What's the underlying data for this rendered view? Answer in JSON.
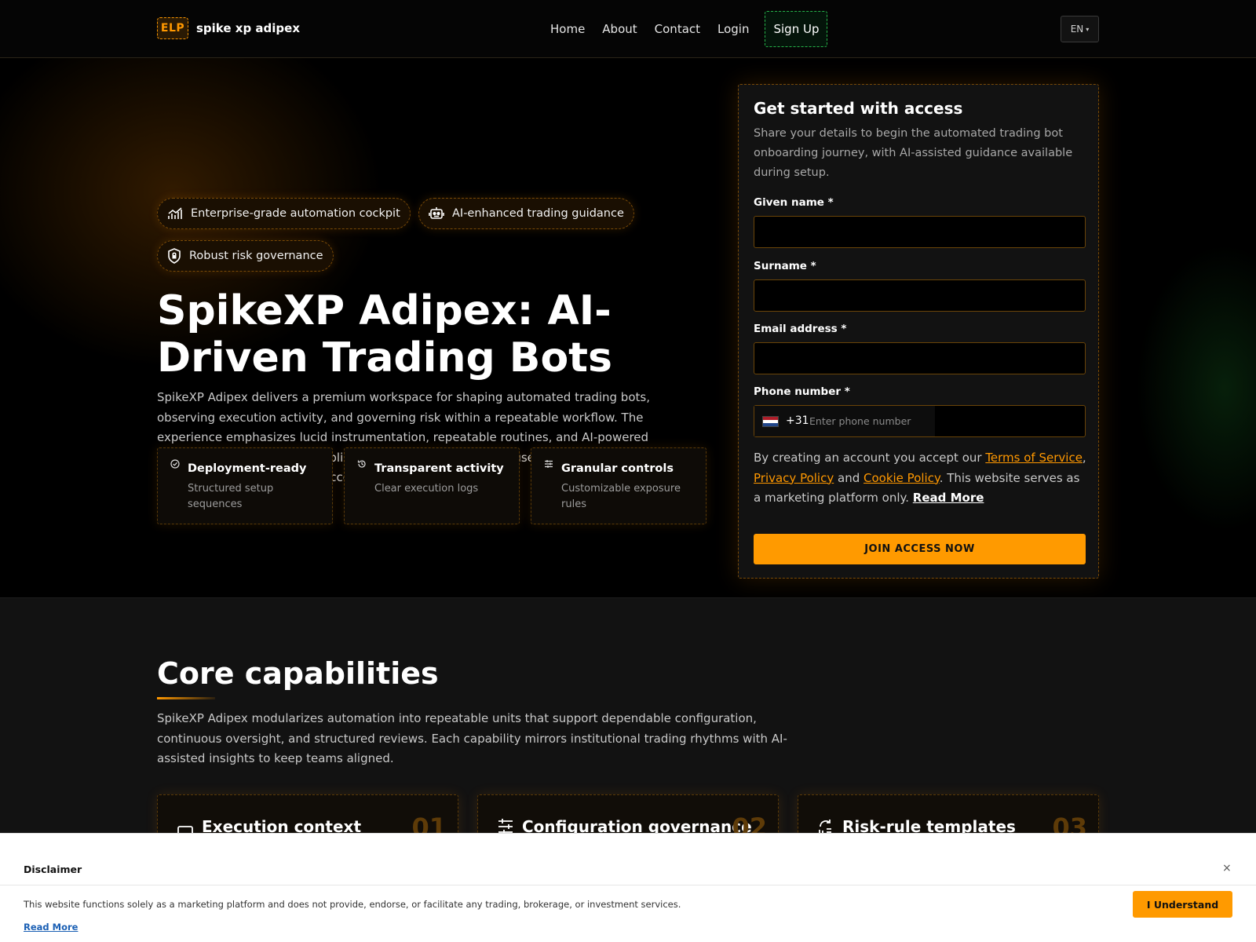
{
  "header": {
    "logo_mark": "ELP",
    "brand_name": "spike xp adipex",
    "nav": [
      "Home",
      "About",
      "Contact",
      "Login"
    ],
    "signup_label": "Sign Up",
    "language": "EN"
  },
  "hero": {
    "chips": [
      {
        "label": "Enterprise-grade automation cockpit",
        "icon": "chart-growth-icon"
      },
      {
        "label": "AI-enhanced trading guidance",
        "icon": "robot-icon"
      },
      {
        "label": "Robust risk governance",
        "icon": "shield-lock-icon"
      }
    ],
    "title": "SpikeXP Adipex: AI-Driven Trading Bots",
    "description": "SpikeXP Adipex delivers a premium workspace for shaping automated trading bots, observing execution activity, and governing risk within a repeatable workflow. The experience emphasizes lucid instrumentation, repeatable routines, and AI-powered summaries that support disciplined decision making. Teams use shared views to align on configurations, checks, and account-wide controls.",
    "features": [
      {
        "title": "Deployment-ready",
        "desc": "Structured setup sequences",
        "icon": "check-badge-icon"
      },
      {
        "title": "Transparent activity",
        "desc": "Clear execution logs",
        "icon": "history-icon"
      },
      {
        "title": "Granular controls",
        "desc": "Customizable exposure rules",
        "icon": "sliders-icon"
      }
    ]
  },
  "form": {
    "title": "Get started with access",
    "subtitle": "Share your details to begin the automated trading bot onboarding journey, with AI-assisted guidance available during setup.",
    "given_name_label": "Given name *",
    "surname_label": "Surname *",
    "email_label": "Email address *",
    "phone_label": "Phone number *",
    "dial_code": "+31",
    "phone_placeholder": "Enter phone number",
    "consent_prefix": "By creating an account you accept our ",
    "terms_link": "Terms of Service",
    "sep1": ", ",
    "privacy_link": "Privacy Policy",
    "sep2": " and ",
    "cookie_link": "Cookie Policy",
    "consent_suffix": ". This website serves as a marketing platform only. ",
    "read_more": "Read More",
    "submit_label": "JOIN ACCESS NOW"
  },
  "capabilities": {
    "title": "Core capabilities",
    "description": "SpikeXP Adipex modularizes automation into repeatable units that support dependable configuration, continuous oversight, and structured reviews. Each capability mirrors institutional trading rhythms with AI-assisted insights to keep teams aligned.",
    "cards": [
      {
        "title": "Execution context",
        "number": "01",
        "icon": "monitor-icon"
      },
      {
        "title": "Configuration governance",
        "number": "02",
        "icon": "sliders-icon"
      },
      {
        "title": "Risk-rule templates",
        "number": "03",
        "icon": "refresh-rules-icon"
      }
    ]
  },
  "disclaimer": {
    "title": "Disclaimer",
    "close": "×",
    "text": "This website functions solely as a marketing platform and does not provide, endorse, or facilitate any trading, brokerage, or investment services.",
    "read_more": "Read More",
    "button": "I Understand"
  }
}
